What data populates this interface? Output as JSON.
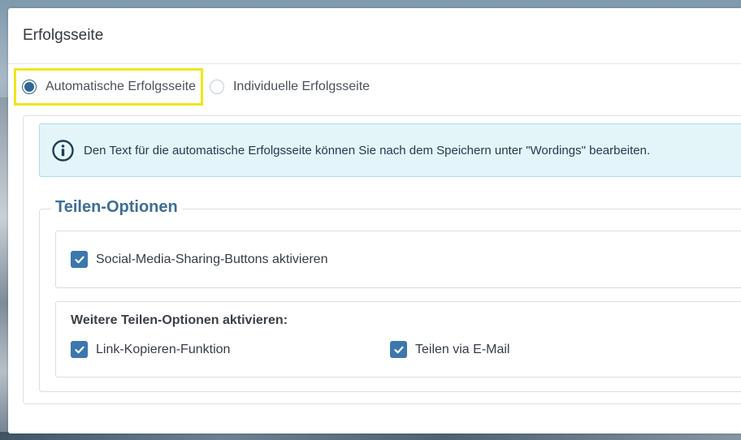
{
  "window": {
    "title": "Erfolgsseite"
  },
  "success_page_mode": {
    "options": [
      {
        "label": "Automatische Erfolgsseite",
        "selected": true
      },
      {
        "label": "Individuelle Erfolgsseite",
        "selected": false
      }
    ]
  },
  "info": {
    "icon": "info-icon",
    "text": "Den Text für die automatische Erfolgsseite können Sie nach dem Speichern unter \"Wordings\" bearbeiten."
  },
  "sharing": {
    "legend": "Teilen-Optionen",
    "social_media": {
      "label": "Social-Media-Sharing-Buttons aktivieren",
      "checked": true
    },
    "further": {
      "title": "Weitere Teilen-Optionen aktivieren:",
      "link_copy": {
        "label": "Link-Kopieren-Funktion",
        "checked": true
      },
      "email": {
        "label": "Teilen via E-Mail",
        "checked": true
      }
    }
  },
  "colors": {
    "accent": "#2f6696",
    "highlight": "#f1e51d",
    "checkbox": "#3c77ad",
    "info_background": "#e4f5fa",
    "legend": "#3f6d96"
  }
}
